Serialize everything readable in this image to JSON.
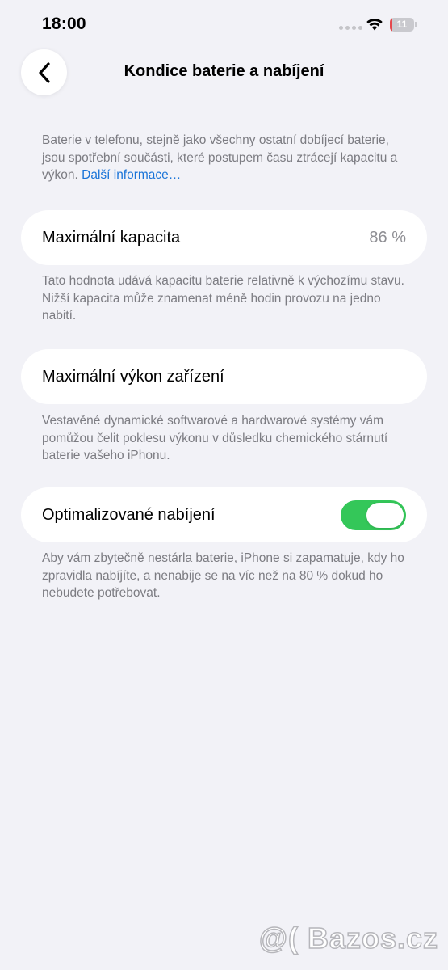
{
  "status_bar": {
    "time": "18:00",
    "battery_level": "11",
    "battery_fraction": 0.11,
    "battery_color": "#e5484d"
  },
  "nav": {
    "back_icon": "chevron-left-icon",
    "title": "Kondice baterie a nabíjení"
  },
  "intro": {
    "text": "Baterie v telefonu, stejně jako všechny ostatní dobíjecí baterie, jsou spotřební součásti, které postupem času ztrácejí kapacitu a výkon.",
    "link": "Další informace…"
  },
  "max_capacity": {
    "label": "Maximální kapacita",
    "value": "86 %",
    "footnote": "Tato hodnota udává kapacitu baterie relativně k výchozímu stavu. Nižší kapacita může znamenat méně hodin provozu na jedno nabití."
  },
  "peak_performance": {
    "label": "Maximální výkon zařízení",
    "footnote": "Vestavěné dynamické softwarové a hardwarové systémy vám pomůžou čelit poklesu výkonu v důsledku chemického stárnutí baterie vašeho iPhonu."
  },
  "optimized_charging": {
    "label": "Optimalizované nabíjení",
    "enabled": true,
    "toggle_color": "#34c759",
    "footnote": "Aby vám zbytečně nestárla baterie, iPhone si zapamatuje, kdy ho zpravidla nabíjíte, a nenabije se na víc než na 80 % dokud ho nebudete potřebovat."
  },
  "watermark": "@( Bazos.cz"
}
